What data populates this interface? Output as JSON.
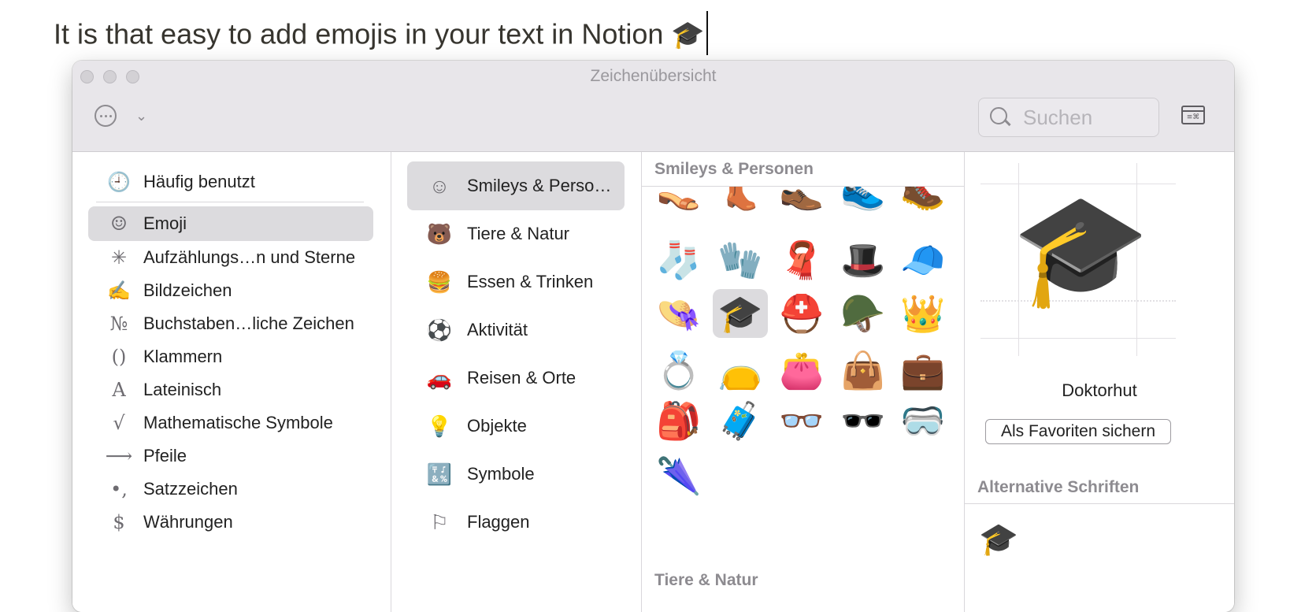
{
  "document": {
    "text": "It is that easy to add emojis in your text in Notion",
    "emoji": "🎓"
  },
  "window": {
    "title": "Zeichenübersicht",
    "search_placeholder": "Suchen"
  },
  "left_sidebar": {
    "items": [
      {
        "label": "Häufig benutzt",
        "icon": "clock-icon",
        "glyph": "🕘",
        "selected": false
      },
      {
        "label": "Emoji",
        "icon": "smiley-icon",
        "glyph": "☺",
        "selected": true
      },
      {
        "label": "Aufzählungs…n und Sterne",
        "icon": "asterisk-icon",
        "glyph": "✳",
        "selected": false
      },
      {
        "label": "Bildzeichen",
        "icon": "writing-hand-icon",
        "glyph": "✍",
        "selected": false
      },
      {
        "label": "Buchstaben…liche Zeichen",
        "icon": "numero-icon",
        "glyph": "№",
        "selected": false
      },
      {
        "label": "Klammern",
        "icon": "parentheses-icon",
        "glyph": "()",
        "selected": false
      },
      {
        "label": "Lateinisch",
        "icon": "latin-a-icon",
        "glyph": "A",
        "selected": false
      },
      {
        "label": "Mathematische Symbole",
        "icon": "square-root-icon",
        "glyph": "√",
        "selected": false
      },
      {
        "label": "Pfeile",
        "icon": "arrow-icon",
        "glyph": "⟶",
        "selected": false
      },
      {
        "label": "Satzzeichen",
        "icon": "punctuation-icon",
        "glyph": "•,",
        "selected": false
      },
      {
        "label": "Währungen",
        "icon": "dollar-icon",
        "glyph": "$",
        "selected": false
      }
    ]
  },
  "categories": {
    "items": [
      {
        "label": "Smileys & Perso…",
        "icon": "smiley-icon",
        "glyph": "☺",
        "selected": true
      },
      {
        "label": "Tiere & Natur",
        "icon": "bear-icon",
        "glyph": "🐻",
        "selected": false
      },
      {
        "label": "Essen & Trinken",
        "icon": "food-icon",
        "glyph": "🍔",
        "selected": false
      },
      {
        "label": "Aktivität",
        "icon": "soccer-ball-icon",
        "glyph": "⚽",
        "selected": false
      },
      {
        "label": "Reisen & Orte",
        "icon": "car-building-icon",
        "glyph": "🚗",
        "selected": false
      },
      {
        "label": "Objekte",
        "icon": "lightbulb-icon",
        "glyph": "💡",
        "selected": false
      },
      {
        "label": "Symbole",
        "icon": "symbols-icon",
        "glyph": "🔣",
        "selected": false
      },
      {
        "label": "Flaggen",
        "icon": "flag-icon",
        "glyph": "⚐",
        "selected": false
      }
    ]
  },
  "emoji_grid": {
    "section_title": "Smileys & Personen",
    "next_section_title": "Tiere & Natur",
    "rows": [
      [
        "👡",
        "👢",
        "👞",
        "👟",
        "🥾"
      ],
      [
        "🧦",
        "🧤",
        "🧣",
        "🎩",
        "🧢"
      ],
      [
        "👒",
        "🎓",
        "⛑️",
        "🪖",
        "👑"
      ],
      [
        "💍",
        "👝",
        "👛",
        "👜",
        "💼"
      ],
      [
        "🎒",
        "🧳",
        "👓",
        "🕶️",
        "🥽"
      ],
      [
        "🌂"
      ]
    ],
    "selected": "🎓"
  },
  "detail": {
    "emoji": "🎓",
    "name": "Doktorhut",
    "favorite_button": "Als Favoriten sichern",
    "alt_fonts_title": "Alternative Schriften",
    "alt_emoji": "🎓"
  }
}
